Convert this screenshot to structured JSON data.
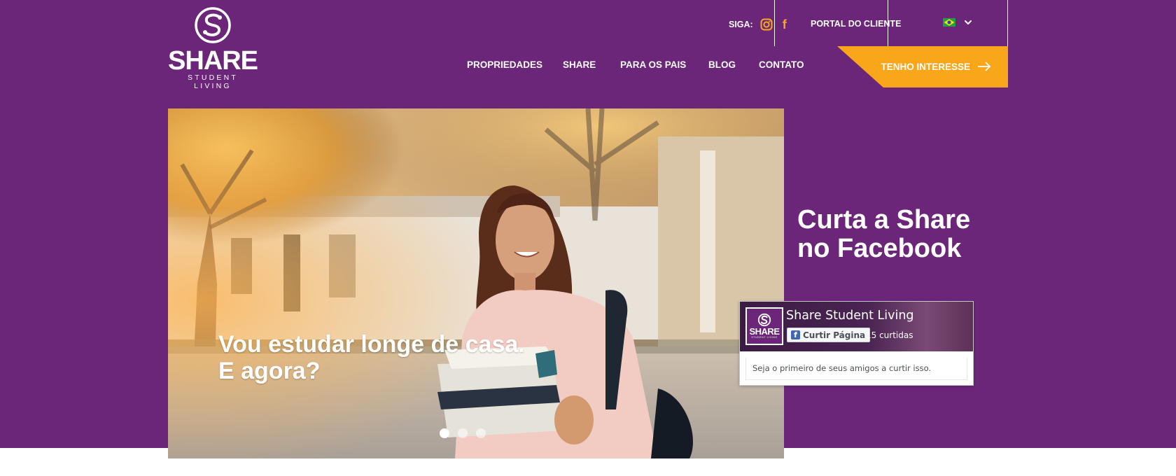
{
  "brand": {
    "name": "SHARE",
    "tagline": "STUDENT LIVING"
  },
  "header": {
    "follow_label": "SIGA:",
    "social_icons": [
      "instagram-icon",
      "facebook-icon"
    ],
    "facebook_glyph": "f",
    "portal_label": "PORTAL DO CLIENTE",
    "language_flag": "brazil-flag-icon",
    "nav": [
      "PROPRIEDADES",
      "SHARE",
      "PARA OS PAIS",
      "BLOG",
      "CONTATO"
    ],
    "cta_label": "TENHO INTERESSE"
  },
  "hero": {
    "caption_line1": "Vou estudar longe de casa.",
    "caption_line2": "E agora?",
    "slides_total": 3,
    "active_slide": 1
  },
  "facebook": {
    "heading_line1": "Curta a Share",
    "heading_line2": "no Facebook",
    "page_name": "Share Student Living",
    "like_button": "Curtir Página",
    "like_count": "15 curtidas",
    "friends_text": "Seja o primeiro de seus amigos a curtir isso."
  },
  "colors": {
    "purple": "#6b2679",
    "accent": "#f9a61a",
    "white": "#ffffff"
  }
}
